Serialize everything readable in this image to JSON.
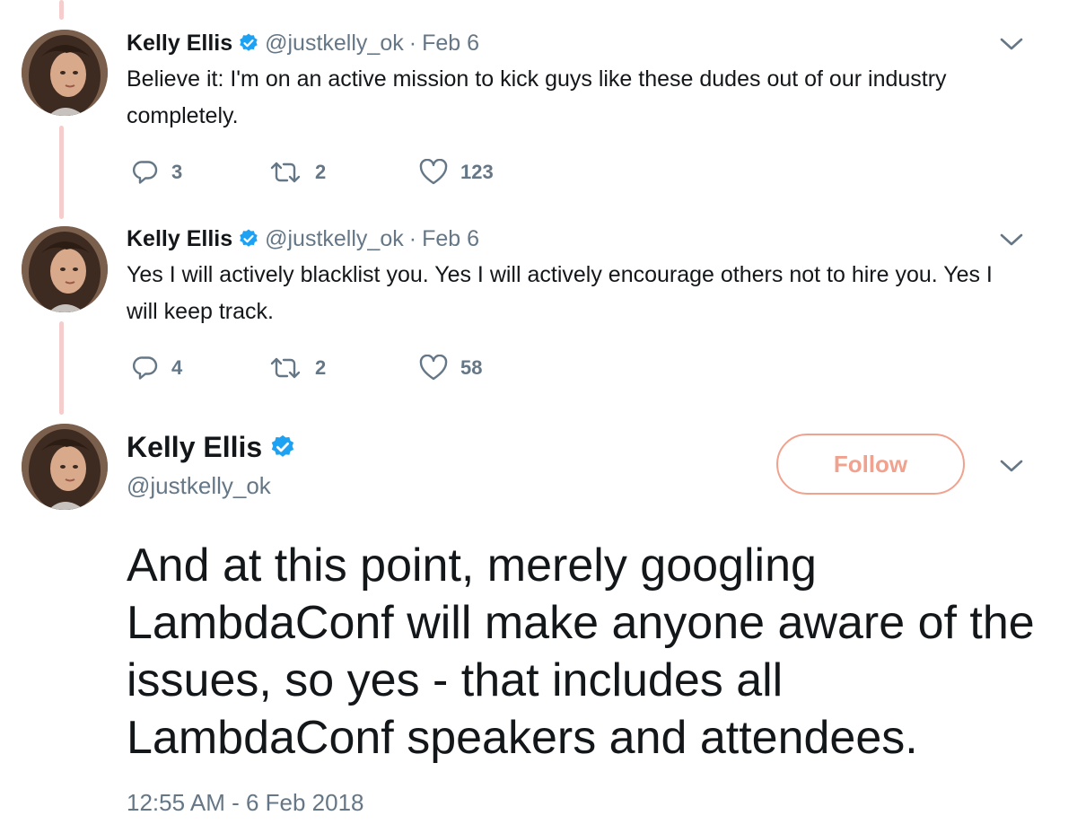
{
  "thread": [
    {
      "name": "Kelly Ellis",
      "handle": "@justkelly_ok",
      "separator": "·",
      "date": "Feb 6",
      "text": "Believe it: I'm on an active mission to kick guys like these dudes out of our industry completely.",
      "replies": "3",
      "retweets": "2",
      "likes": "123"
    },
    {
      "name": "Kelly Ellis",
      "handle": "@justkelly_ok",
      "separator": "·",
      "date": "Feb 6",
      "text": "Yes I will actively blacklist you. Yes I will actively encourage others not to hire you. Yes I will keep track.",
      "replies": "4",
      "retweets": "2",
      "likes": "58"
    }
  ],
  "main_tweet": {
    "name": "Kelly Ellis",
    "handle": "@justkelly_ok",
    "follow_label": "Follow",
    "text": "And at this point, merely googling LambdaConf will make anyone aware of the issues, so yes - that includes all LambdaConf speakers and attendees.",
    "timestamp": "12:55 AM - 6 Feb 2018"
  },
  "icons": {
    "verified": "verified-badge-icon",
    "chevron": "chevron-down-icon",
    "reply": "reply-icon",
    "retweet": "retweet-icon",
    "like": "heart-icon"
  },
  "colors": {
    "verified_blue": "#1da1f2",
    "follow_accent": "#f0a28e",
    "thread_line": "#f5cdcd",
    "secondary_text": "#657786"
  }
}
